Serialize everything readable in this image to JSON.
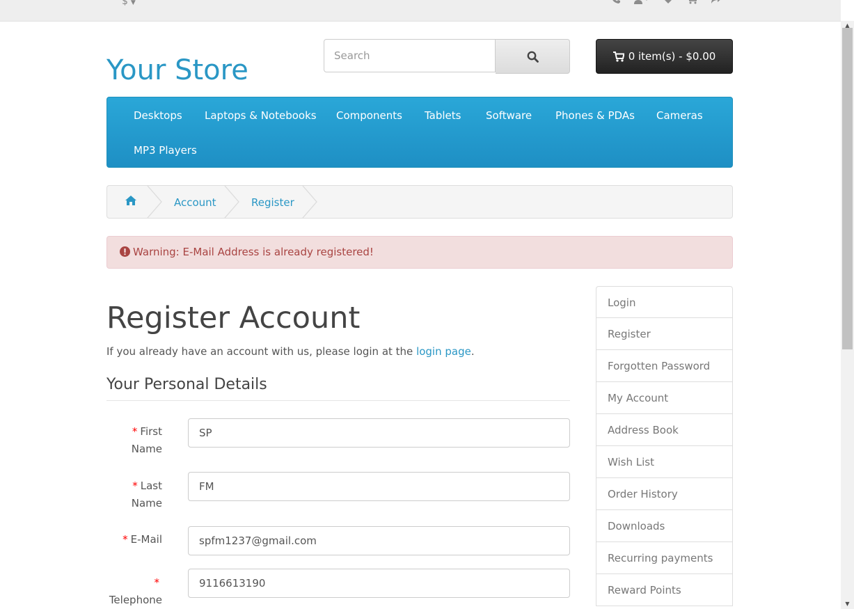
{
  "topbar": {
    "currency": "$",
    "icons": [
      "phone-icon",
      "user-icon",
      "heart-icon",
      "cart-icon",
      "share-icon"
    ]
  },
  "header": {
    "logo": "Your Store",
    "search_placeholder": "Search",
    "cart_label": "0 item(s) - $0.00"
  },
  "menu": {
    "items": [
      "Desktops",
      "Laptops & Notebooks",
      "Components",
      "Tablets",
      "Software",
      "Phones & PDAs",
      "Cameras",
      "MP3 Players"
    ]
  },
  "breadcrumb": {
    "home_icon": "home-icon",
    "items": [
      "Account",
      "Register"
    ]
  },
  "alert": {
    "text": "Warning: E-Mail Address is already registered!"
  },
  "main": {
    "title": "Register Account",
    "intro_prefix": "If you already have an account with us, please login at the ",
    "intro_link": "login page",
    "intro_suffix": ".",
    "section_title": "Your Personal Details",
    "fields": [
      {
        "label_line1": "First",
        "label_line2": "Name",
        "value": "SP"
      },
      {
        "label_line1": "Last",
        "label_line2": "Name",
        "value": "FM"
      },
      {
        "label_line1": "E-Mail",
        "value": "spfm1237@gmail.com"
      },
      {
        "label_line2": "Telephone",
        "value": "9116613190"
      }
    ],
    "required_mark": "*"
  },
  "sidebar": {
    "items": [
      "Login",
      "Register",
      "Forgotten Password",
      "My Account",
      "Address Book",
      "Wish List",
      "Order History",
      "Downloads",
      "Recurring payments",
      "Reward Points"
    ]
  },
  "colors": {
    "link": "#2a97c5",
    "menu": "#229ac8",
    "alert_bg": "#f2dede",
    "alert_text": "#a94442",
    "required": "#ff0000"
  }
}
